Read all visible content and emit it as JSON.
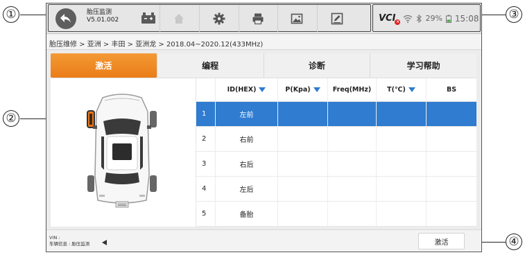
{
  "callouts": [
    "①",
    "②",
    "③",
    "④"
  ],
  "topbar": {
    "app_name": "胎压监测",
    "app_version": "V5.01.002",
    "icons": [
      "back-icon",
      "vci-connector-icon",
      "home-icon",
      "settings-icon",
      "print-icon",
      "image-icon",
      "edit-icon"
    ]
  },
  "status": {
    "vci_label": "VCI",
    "wifi": "wifi-icon",
    "bluetooth": "bluetooth-icon",
    "battery": "29%",
    "time": "15:08"
  },
  "breadcrumb": "胎压维修 > 亚洲 > 丰田 > 亚洲龙 > 2018.04~2020.12(433MHz)",
  "tabs": [
    {
      "label": "激活",
      "active": true
    },
    {
      "label": "编程",
      "active": false
    },
    {
      "label": "诊断",
      "active": false
    },
    {
      "label": "学习帮助",
      "active": false
    }
  ],
  "table": {
    "headers": [
      "",
      "ID(HEX)",
      "P(Kpa)",
      "Freq(MHz)",
      "T(℃)",
      "BS"
    ],
    "rows": [
      {
        "index": "1",
        "position": "左前",
        "selected": true
      },
      {
        "index": "2",
        "position": "右前",
        "selected": false
      },
      {
        "index": "3",
        "position": "右后",
        "selected": false
      },
      {
        "index": "4",
        "position": "左后",
        "selected": false
      },
      {
        "index": "5",
        "position": "备胎",
        "selected": false
      }
    ]
  },
  "footer": {
    "vin_label": "VIN :",
    "vehicle_info": "车辆信息 : 胎压监测",
    "activate_button": "激活"
  },
  "colors": {
    "accent_orange": "#ea7d18",
    "selected_blue": "#2f7cd1",
    "highlight_tire": "#e8761a"
  }
}
